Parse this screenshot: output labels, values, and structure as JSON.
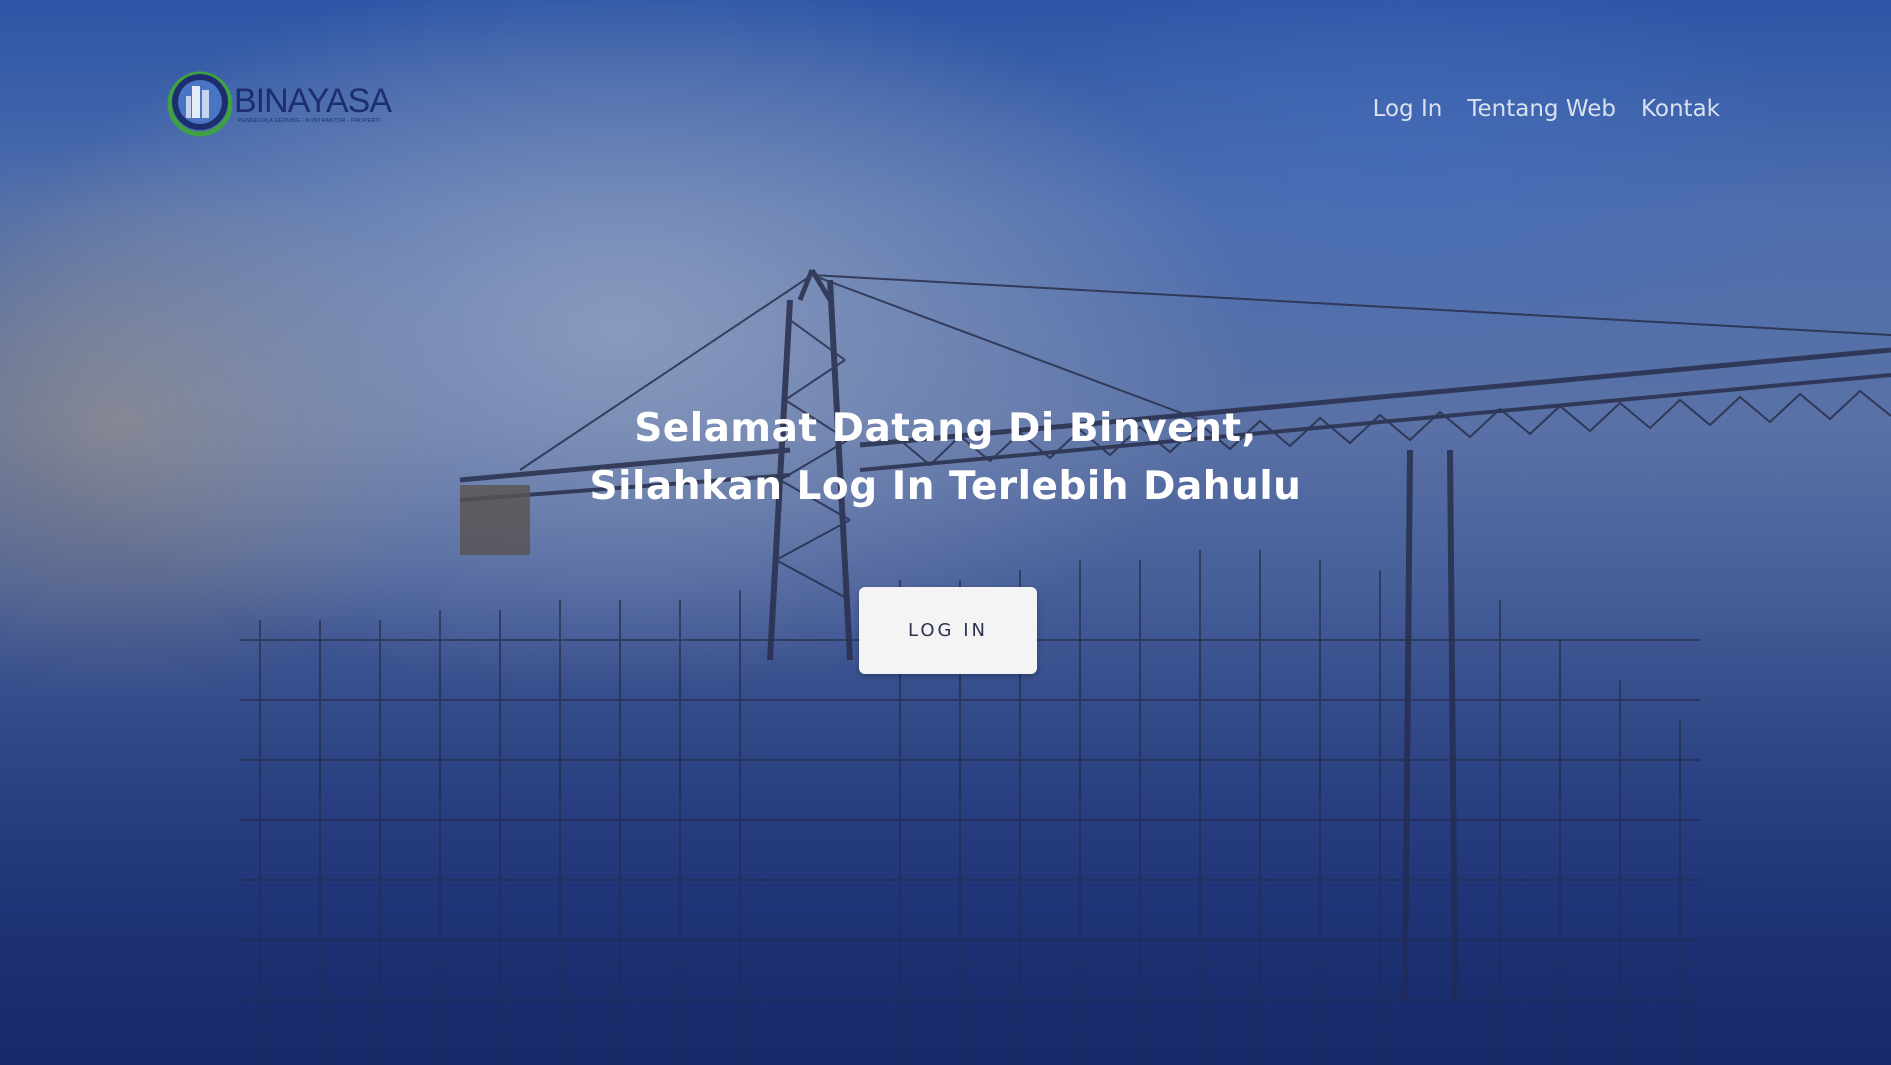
{
  "brand": {
    "name": "BINAYASA",
    "tagline": "PENGELOLA GEDUNG - KONTRAKTOR - PROPERTI",
    "logo_icon": "building-globe-logo"
  },
  "nav": {
    "items": [
      {
        "label": "Log In"
      },
      {
        "label": "Tentang Web"
      },
      {
        "label": "Kontak"
      }
    ]
  },
  "hero": {
    "headline_line1": "Selamat Datang Di Binvent,",
    "headline_line2": "Silahkan Log In Terlebih Dahulu",
    "cta_label": "LOG IN",
    "background_image": "construction-crane-scaffolding"
  },
  "colors": {
    "accent_dark_blue": "#1d2e6e",
    "nav_text": "#d9e0ee",
    "button_bg": "#f4f4f5",
    "logo_green": "#3fa046"
  }
}
